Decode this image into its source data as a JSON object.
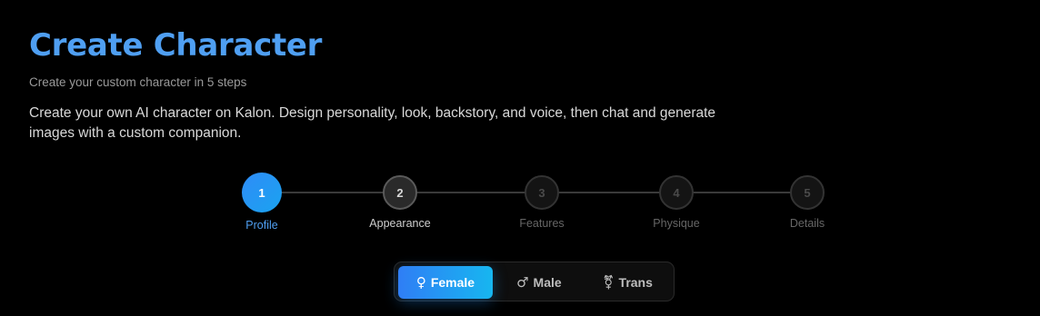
{
  "header": {
    "title": "Create Character",
    "subtitle": "Create your custom character in 5 steps",
    "description": "Create your own AI character on Kalon. Design personality, look, backstory, and voice, then chat and generate images with a custom companion."
  },
  "stepper": {
    "current_step": 1,
    "steps": [
      {
        "number": "1",
        "label": "Profile",
        "state": "active"
      },
      {
        "number": "2",
        "label": "Appearance",
        "state": "next"
      },
      {
        "number": "3",
        "label": "Features",
        "state": "pending"
      },
      {
        "number": "4",
        "label": "Physique",
        "state": "pending"
      },
      {
        "number": "5",
        "label": "Details",
        "state": "pending"
      }
    ]
  },
  "gender_toggle": {
    "selected": "Female",
    "options": [
      {
        "label": "Female",
        "icon": "female-icon",
        "glyph": "♀"
      },
      {
        "label": "Male",
        "icon": "male-icon",
        "glyph": "♂"
      },
      {
        "label": "Trans",
        "icon": "transgender-icon",
        "glyph": "⚧"
      }
    ]
  },
  "colors": {
    "background": "#000000",
    "accent": "#4f9ff2",
    "gradient_start": "#2f7ef5",
    "gradient_end": "#17b6f0"
  }
}
